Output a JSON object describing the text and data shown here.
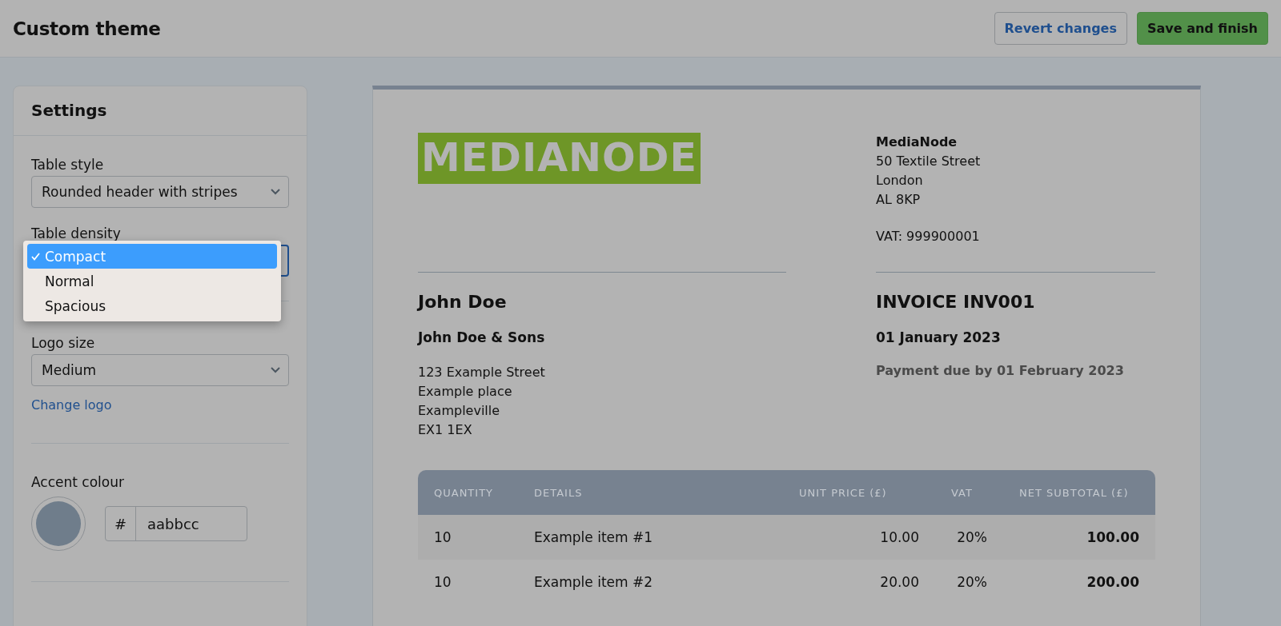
{
  "header": {
    "title": "Custom theme",
    "buttons": [
      {
        "label": "Revert changes",
        "kind": "secondary"
      },
      {
        "label": "Save and finish",
        "kind": "primary"
      }
    ]
  },
  "settings": {
    "title": "Settings",
    "table_style": {
      "label": "Table style",
      "value": "Rounded header with stripes"
    },
    "table_density": {
      "label": "Table density",
      "expanded": true,
      "options": [
        {
          "label": "Compact",
          "selected": true
        },
        {
          "label": "Normal",
          "selected": false
        },
        {
          "label": "Spacious",
          "selected": false
        }
      ]
    },
    "logo_size": {
      "label": "Logo size",
      "value": "Medium",
      "link": "Change logo"
    },
    "accent_colour": {
      "label": "Accent colour",
      "prefix": "#",
      "value": "aabbcc"
    }
  },
  "invoice": {
    "logo": "MEDIANODE",
    "company": {
      "name": "MediaNode",
      "lines": [
        "50 Textile Street",
        "London",
        "AL 8KP"
      ],
      "vat": "VAT: 999900001"
    },
    "customer": {
      "name": "John Doe",
      "company": "John Doe & Sons",
      "lines": [
        "123 Example Street",
        "Example place",
        "Exampleville",
        "EX1 1EX"
      ]
    },
    "title": "INVOICE INV001",
    "date": "01 January 2023",
    "due": "Payment due by 01 February 2023",
    "table": {
      "columns": [
        "QUANTITY",
        "DETAILS",
        "UNIT PRICE (£)",
        "VAT",
        "NET SUBTOTAL (£)"
      ],
      "rows": [
        [
          "10",
          "Example item #1",
          "10.00",
          "20%",
          "100.00"
        ],
        [
          "10",
          "Example item #2",
          "20.00",
          "20%",
          "200.00"
        ]
      ]
    }
  }
}
